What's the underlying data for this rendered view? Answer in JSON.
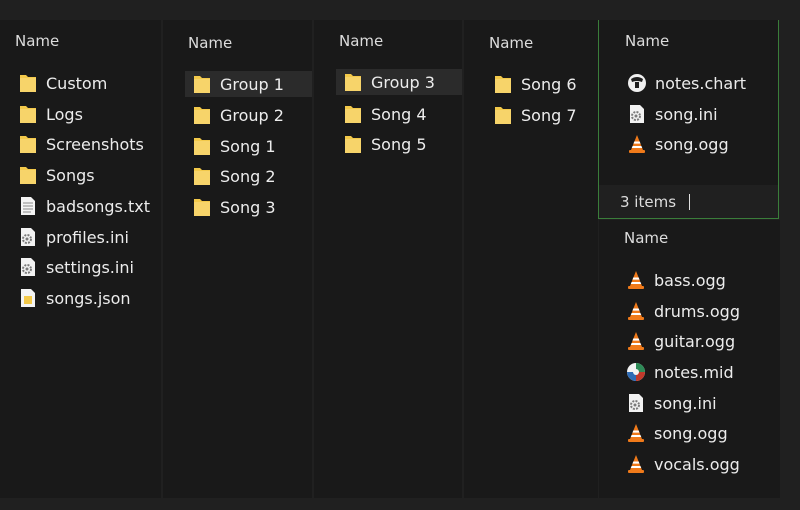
{
  "columns": [
    {
      "header": "Name",
      "items": [
        {
          "label": "Custom",
          "icon": "folder-icon"
        },
        {
          "label": "Logs",
          "icon": "folder-icon"
        },
        {
          "label": "Screenshots",
          "icon": "folder-icon"
        },
        {
          "label": "Songs",
          "icon": "folder-icon"
        },
        {
          "label": "badsongs.txt",
          "icon": "text-file-icon"
        },
        {
          "label": "profiles.ini",
          "icon": "settings-file-icon"
        },
        {
          "label": "settings.ini",
          "icon": "settings-file-icon"
        },
        {
          "label": "songs.json",
          "icon": "json-file-icon"
        }
      ]
    },
    {
      "header": "Name",
      "items": [
        {
          "label": "Group 1",
          "icon": "folder-icon",
          "selected": true
        },
        {
          "label": "Group 2",
          "icon": "folder-icon"
        },
        {
          "label": "Song 1",
          "icon": "folder-icon"
        },
        {
          "label": "Song 2",
          "icon": "folder-icon"
        },
        {
          "label": "Song 3",
          "icon": "folder-icon"
        }
      ]
    },
    {
      "header": "Name",
      "items": [
        {
          "label": "Group 3",
          "icon": "folder-icon",
          "selected": true
        },
        {
          "label": "Song 4",
          "icon": "folder-icon"
        },
        {
          "label": "Song 5",
          "icon": "folder-icon"
        }
      ]
    },
    {
      "header": "Name",
      "items": [
        {
          "label": "Song 6",
          "icon": "folder-icon"
        },
        {
          "label": "Song 7",
          "icon": "folder-icon"
        }
      ]
    }
  ],
  "top_window": {
    "header": "Name",
    "items": [
      {
        "label": "notes.chart",
        "icon": "chart-file-icon"
      },
      {
        "label": "song.ini",
        "icon": "settings-file-icon"
      },
      {
        "label": "song.ogg",
        "icon": "vlc-cone-icon"
      }
    ],
    "status": "3 items"
  },
  "bottom_window": {
    "header": "Name",
    "items": [
      {
        "label": "bass.ogg",
        "icon": "vlc-cone-icon"
      },
      {
        "label": "drums.ogg",
        "icon": "vlc-cone-icon"
      },
      {
        "label": "guitar.ogg",
        "icon": "vlc-cone-icon"
      },
      {
        "label": "notes.mid",
        "icon": "midi-file-icon"
      },
      {
        "label": "song.ini",
        "icon": "settings-file-icon"
      },
      {
        "label": "song.ogg",
        "icon": "vlc-cone-icon"
      },
      {
        "label": "vocals.ogg",
        "icon": "vlc-cone-icon"
      }
    ]
  },
  "colors": {
    "folder": "#f3c94a",
    "vlc_orange": "#f07a1a",
    "accent_border": "#3a7d3a"
  }
}
